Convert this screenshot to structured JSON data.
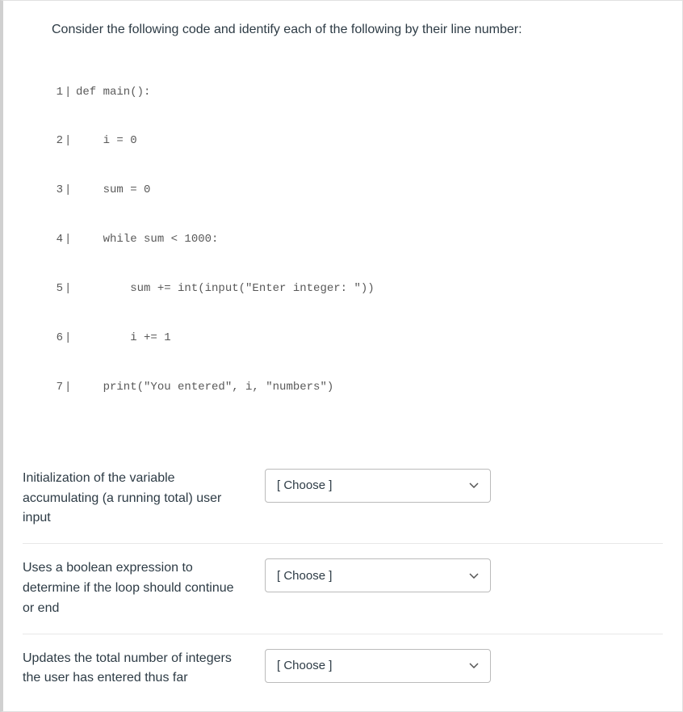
{
  "question": {
    "prompt": "Consider the following code and identify each of the following by their line number:",
    "code_lines": [
      {
        "n": "1",
        "text": "def main():"
      },
      {
        "n": "2",
        "text": "    i = 0"
      },
      {
        "n": "3",
        "text": "    sum = 0"
      },
      {
        "n": "4",
        "text": "    while sum < 1000:"
      },
      {
        "n": "5",
        "text": "        sum += int(input(\"Enter integer: \"))"
      },
      {
        "n": "6",
        "text": "        i += 1"
      },
      {
        "n": "7",
        "text": "    print(\"You entered\", i, \"numbers\")"
      }
    ]
  },
  "matches": [
    {
      "label": "Initialization of the variable accumulating (a running total) user input",
      "placeholder": "[ Choose ]"
    },
    {
      "label": "Uses a boolean expression to determine if the loop should continue or end",
      "placeholder": "[ Choose ]"
    },
    {
      "label": "Updates the total number of integers the user has entered thus far",
      "placeholder": "[ Choose ]"
    }
  ]
}
